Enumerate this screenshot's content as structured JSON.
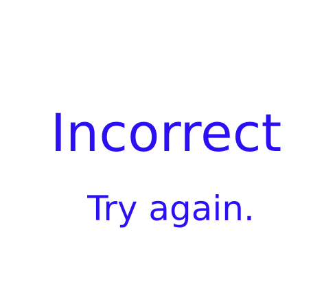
{
  "feedback": {
    "title": "Incorrect",
    "message": "Try again."
  },
  "colors": {
    "text": "#2a10f2",
    "background": "#ffffff"
  }
}
